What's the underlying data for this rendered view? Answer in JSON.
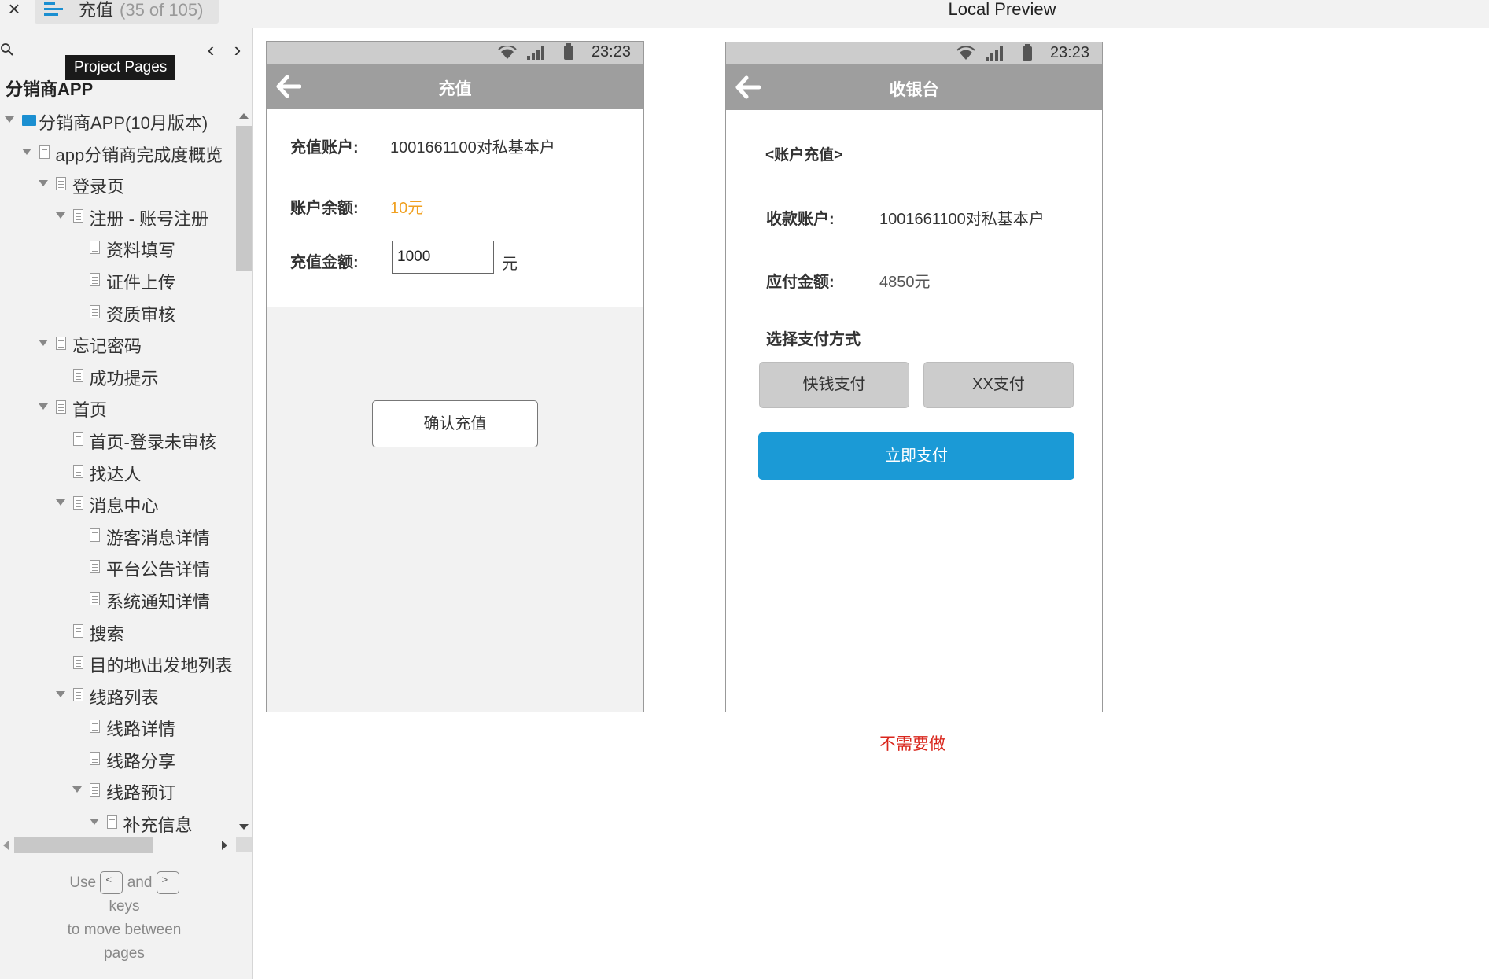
{
  "topbar": {
    "close_label": "×",
    "page_title": "充值",
    "page_count": "(35 of 105)",
    "preview_title": "Local Preview"
  },
  "sidebar": {
    "tooltip": "Project Pages",
    "prev_label": "‹",
    "next_label": "›",
    "project_name": "分销商APP",
    "tree": [
      {
        "label": "分销商APP(10月版本)",
        "level": 0,
        "type": "folder",
        "expanded": true
      },
      {
        "label": "app分销商完成度概览",
        "level": 1,
        "type": "page",
        "expanded": true
      },
      {
        "label": "登录页",
        "level": 2,
        "type": "page",
        "expanded": true
      },
      {
        "label": "注册 - 账号注册",
        "level": 3,
        "type": "page",
        "expanded": true
      },
      {
        "label": "资料填写",
        "level": 4,
        "type": "page"
      },
      {
        "label": "证件上传",
        "level": 4,
        "type": "page"
      },
      {
        "label": "资质审核",
        "level": 4,
        "type": "page"
      },
      {
        "label": "忘记密码",
        "level": 2,
        "type": "page",
        "expanded": true
      },
      {
        "label": "成功提示",
        "level": 3,
        "type": "page"
      },
      {
        "label": "首页",
        "level": 2,
        "type": "page",
        "expanded": true
      },
      {
        "label": "首页-登录未审核",
        "level": 3,
        "type": "page"
      },
      {
        "label": "找达人",
        "level": 3,
        "type": "page"
      },
      {
        "label": "消息中心",
        "level": 3,
        "type": "page",
        "expanded": true
      },
      {
        "label": "游客消息详情",
        "level": 4,
        "type": "page"
      },
      {
        "label": "平台公告详情",
        "level": 4,
        "type": "page"
      },
      {
        "label": "系统通知详情",
        "level": 4,
        "type": "page"
      },
      {
        "label": "搜索",
        "level": 3,
        "type": "page"
      },
      {
        "label": "目的地\\出发地列表",
        "level": 3,
        "type": "page"
      },
      {
        "label": "线路列表",
        "level": 3,
        "type": "page",
        "expanded": true
      },
      {
        "label": "线路详情",
        "level": 4,
        "type": "page"
      },
      {
        "label": "线路分享",
        "level": 4,
        "type": "page"
      },
      {
        "label": "线路预订",
        "level": 4,
        "type": "page",
        "expanded": true
      },
      {
        "label": "补充信息",
        "level": 5,
        "type": "page",
        "expanded": true
      }
    ],
    "hint": {
      "use": "Use",
      "key_prev": "<",
      "and": "and",
      "key_next": ">",
      "keys": "keys",
      "line3": "to move between",
      "line4": "pages"
    }
  },
  "phone1": {
    "time": "23:23",
    "title": "充值",
    "account_label": "充值账户:",
    "account_value": "1001661100对私基本户",
    "balance_label": "账户余额:",
    "balance_value": "10元",
    "balance_color": "#f0a020",
    "amount_label": "充值金额:",
    "amount_value": "1000",
    "amount_unit": "元",
    "confirm_label": "确认充值"
  },
  "phone2": {
    "time": "23:23",
    "title": "收银台",
    "section_title": "<账户充值>",
    "payee_label": "收款账户:",
    "payee_value": "1001661100对私基本户",
    "due_label": "应付金额:",
    "due_value": "4850元",
    "pay_method_label": "选择支付方式",
    "pay_options": [
      "快钱支付",
      "XX支付"
    ],
    "pay_now_label": "立即支付",
    "accent_color": "#1b9ad6"
  },
  "note": "不需要做"
}
